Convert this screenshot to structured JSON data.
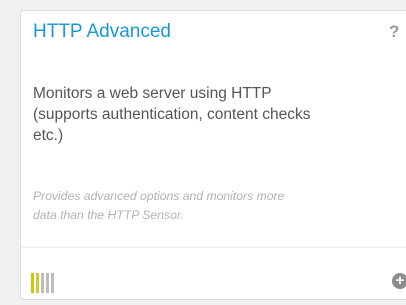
{
  "card": {
    "title": "HTTP Advanced",
    "help_label": "?",
    "description_lines": [
      "Monitors a web server using HTTP",
      "(supports authentication, content checks",
      "etc.)"
    ],
    "subdescription_lines": [
      "Provides advanced options and monitors more",
      "data than the HTTP Sensor."
    ],
    "performance_impact": {
      "level": 2,
      "of": 5,
      "colors": [
        "#d6c500",
        "#c9cc3a",
        "#bdbdbd",
        "#bdbdbd",
        "#bdbdbd"
      ]
    },
    "add_icon": "plus-circle-icon",
    "add_label": "+"
  },
  "colors": {
    "title": "#1b98d4",
    "text": "#555555",
    "muted": "#b3b3b3"
  }
}
